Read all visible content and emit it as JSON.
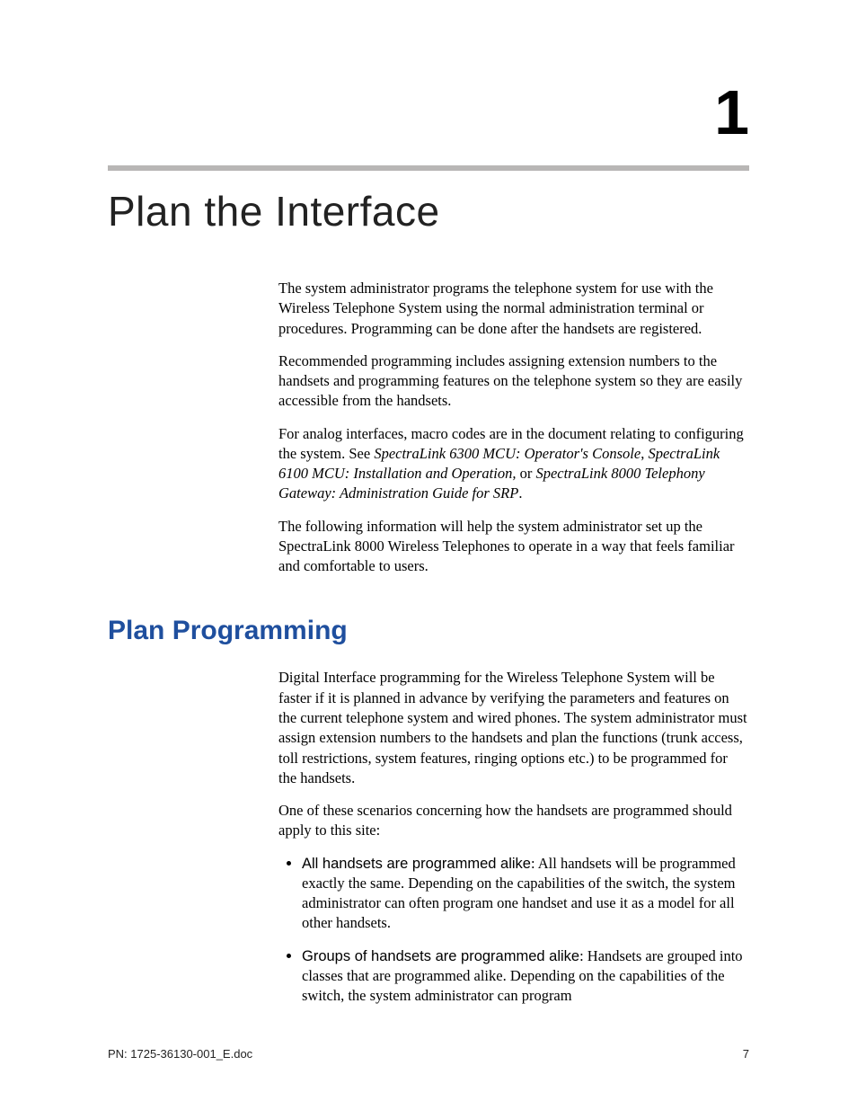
{
  "chapter": {
    "number": "1",
    "title": "Plan the Interface"
  },
  "intro": {
    "p1": "The system administrator programs the telephone system for use with the Wireless Telephone System using the normal administration terminal or procedures.  Programming can be done after the handsets are registered.",
    "p2": "Recommended programming includes assigning extension numbers to the handsets and programming features on the telephone system so they are easily accessible from the handsets.",
    "p3_a": "For analog interfaces, macro codes are in the document relating to configuring the system. See ",
    "p3_i1": "SpectraLink 6300 MCU: Operator's Console",
    "p3_b": ", ",
    "p3_i2": "SpectraLink 6100 MCU: Installation and Operation,",
    "p3_c": " or ",
    "p3_i3": "SpectraLink 8000 Telephony Gateway: Administration Guide for SRP",
    "p3_d": ".",
    "p4": "The following information will help the system administrator set up the SpectraLink 8000 Wireless Telephones to operate in a way that feels familiar and comfortable to users."
  },
  "section": {
    "heading": "Plan Programming",
    "p1": "Digital Interface programming for the Wireless Telephone System will be faster if it is planned in advance by verifying the parameters and features on the current telephone system and wired phones.  The system administrator must assign extension numbers to the handsets and plan the functions (trunk access, toll restrictions, system features, ringing options etc.) to be programmed for the handsets.",
    "p2": "One of these scenarios concerning how the handsets are programmed should apply to this site:",
    "bullets": [
      {
        "lead": "All handsets are programmed alike",
        "rest": ": All handsets will be programmed exactly the same.  Depending on the capabilities of the switch, the system administrator can often program one handset and use it as a model for all other handsets."
      },
      {
        "lead": "Groups of handsets are programmed alike",
        "rest": ": Handsets are grouped into classes that are programmed alike.  Depending on the capabilities of the switch, the system administrator can program"
      }
    ]
  },
  "footer": {
    "left": "PN: 1725-36130-001_E.doc",
    "right": "7"
  }
}
